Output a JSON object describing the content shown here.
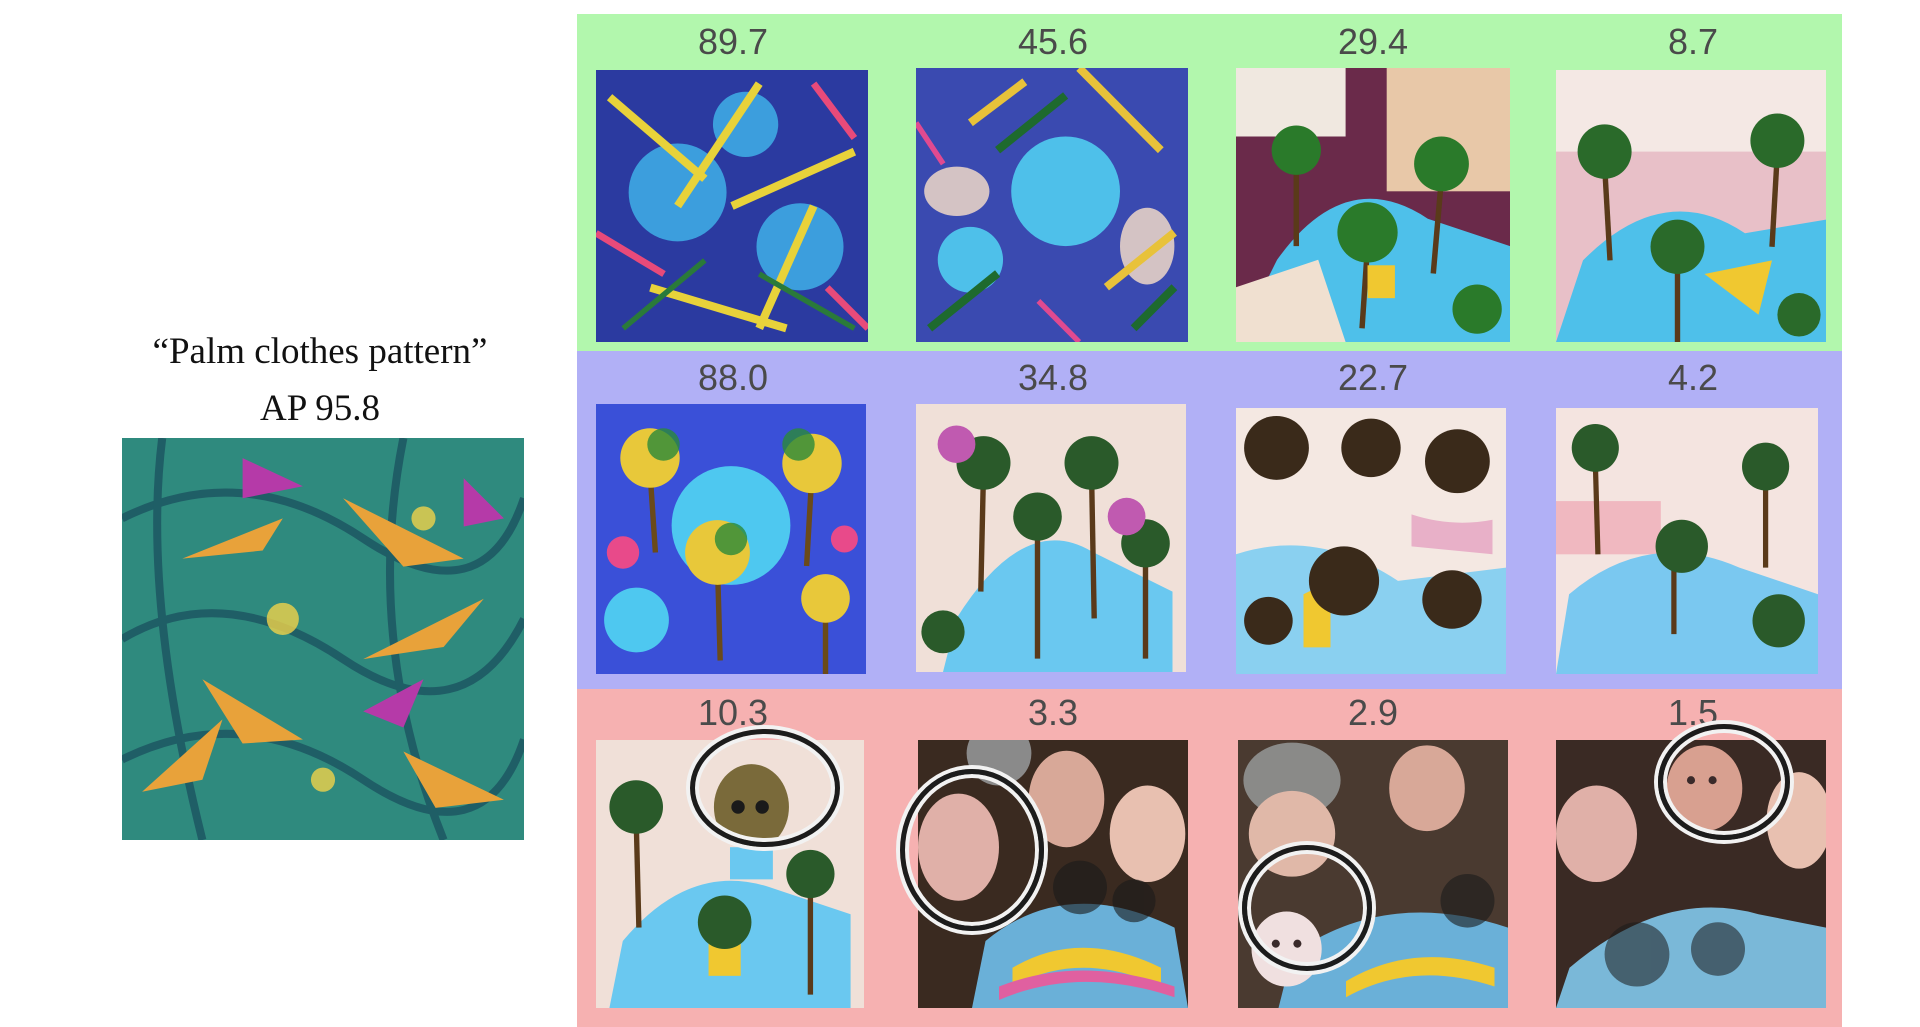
{
  "figure": {
    "prompt_label": "“Palm clothes pattern”",
    "ap_label": "AP 95.8",
    "rows": [
      {
        "color": "#b2f7ad",
        "scores": [
          "89.7",
          "45.6",
          "29.4",
          "8.7"
        ]
      },
      {
        "color": "#b1b0f6",
        "scores": [
          "88.0",
          "34.8",
          "22.7",
          "4.2"
        ]
      },
      {
        "color": "#f6b1b1",
        "scores": [
          "10.3",
          "3.3",
          "2.9",
          "1.5"
        ]
      }
    ]
  }
}
